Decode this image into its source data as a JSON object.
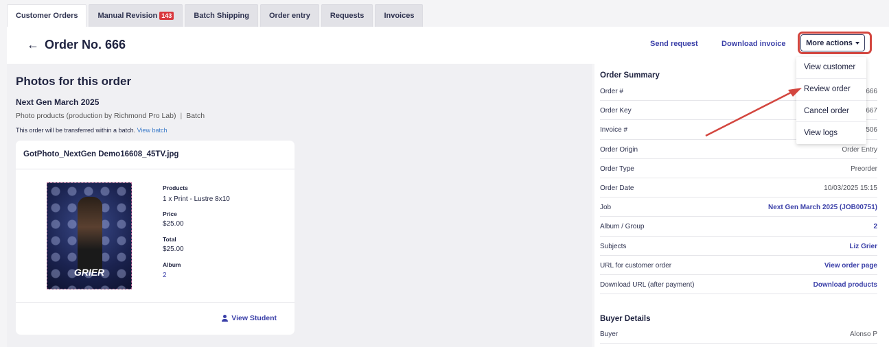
{
  "tabs": [
    {
      "label": "Customer Orders",
      "active": true
    },
    {
      "label": "Manual Revision",
      "badge": "143"
    },
    {
      "label": "Batch Shipping"
    },
    {
      "label": "Order entry"
    },
    {
      "label": "Requests"
    },
    {
      "label": "Invoices"
    }
  ],
  "header": {
    "back_icon": "←",
    "title": "Order No. 666",
    "send_request": "Send request",
    "download_invoice": "Download invoice",
    "more_actions": "More actions"
  },
  "left": {
    "heading": "Photos for this order",
    "job_name": "Next Gen March 2025",
    "product_line": "Photo products (production by Richmond Pro Lab)",
    "product_type": "Batch",
    "note": "This order will be transferred within a batch.",
    "note_link": "View batch",
    "card": {
      "filename": "GotPhoto_NextGen Demo16608_45TV.jpg",
      "photo_text": "GRIER",
      "products_label": "Products",
      "products_value": "1 x Print - Lustre 8x10",
      "price_label": "Price",
      "price_value": "$25.00",
      "total_label": "Total",
      "total_value": "$25.00",
      "album_label": "Album",
      "album_value": "2",
      "view_student": "View Student"
    }
  },
  "summary": {
    "title": "Order Summary",
    "rows": [
      {
        "key": "Order #",
        "value": "666"
      },
      {
        "key": "Order Key",
        "value": "667"
      },
      {
        "key": "Invoice #",
        "value": "506"
      },
      {
        "key": "Order Origin",
        "value": "Order Entry"
      },
      {
        "key": "Order Type",
        "value": "Preorder"
      },
      {
        "key": "Order Date",
        "value": "10/03/2025 15:15"
      },
      {
        "key": "Job",
        "value": "Next Gen March 2025 (JOB00751)"
      },
      {
        "key": "Album / Group",
        "value": "2"
      },
      {
        "key": "Subjects",
        "value": "Liz Grier"
      },
      {
        "key": "URL for customer order",
        "value": "View order page"
      },
      {
        "key": "Download URL (after payment)",
        "value": "Download products"
      }
    ],
    "buyer_title": "Buyer Details",
    "buyer_key": "Buyer",
    "buyer_value": "Alonso P"
  },
  "dropdown": [
    "View customer",
    "Review order",
    "Cancel order",
    "View logs"
  ],
  "colors": {
    "accent": "#3a3fa8",
    "badge": "#d9383e",
    "annotation": "#d3463f"
  }
}
